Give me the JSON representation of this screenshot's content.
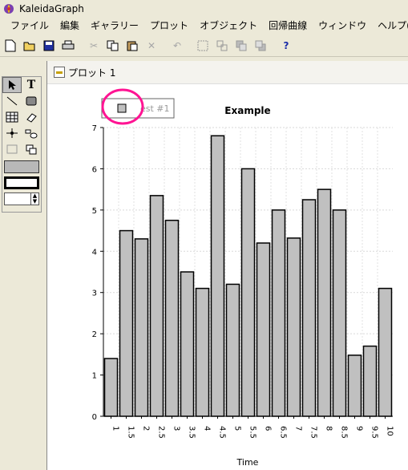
{
  "app": {
    "title": "KaleidaGraph"
  },
  "menu": [
    "ファイル",
    "編集",
    "ギャラリー",
    "プロット",
    "オブジェクト",
    "回帰曲線",
    "ウィンドウ",
    "ヘルプ(H)"
  ],
  "toolbar": {
    "help_label": "?",
    "buttons": [
      "new-icon",
      "open-icon",
      "save-icon",
      "print-icon",
      "cut-icon",
      "copy-icon",
      "paste-icon",
      "delete-icon",
      "undo-icon",
      "group-icon",
      "ungroup-icon",
      "bring-front-icon",
      "send-back-icon",
      "help-icon"
    ]
  },
  "window": {
    "title": "プロット 1"
  },
  "palette": {
    "text_tool": "T"
  },
  "chart_data": {
    "type": "bar",
    "title": "Example",
    "xlabel": "Time",
    "ylabel": "",
    "ylim": [
      0,
      7
    ],
    "yticks": [
      0,
      1,
      2,
      3,
      4,
      5,
      6,
      7
    ],
    "grid": true,
    "legend": {
      "placement": "top-left",
      "entries": [
        "Test #1"
      ],
      "label_visible": "est #1"
    },
    "bar_color": "#c0c0c0",
    "categories": [
      "1",
      "1.5",
      "2",
      "2.5",
      "3",
      "3.5",
      "4",
      "4.5",
      "5",
      "5.5",
      "6",
      "6.5",
      "7",
      "7.5",
      "8",
      "8.5",
      "9",
      "9.5",
      "10"
    ],
    "values": [
      1.4,
      4.5,
      4.3,
      5.35,
      4.75,
      3.5,
      3.1,
      6.8,
      3.2,
      6.0,
      4.2,
      5.0,
      4.32,
      5.25,
      5.5,
      5.0,
      1.48,
      1.7,
      3.1
    ]
  },
  "annotation": {
    "color": "#ff1493",
    "shape": "circle",
    "target": "legend"
  }
}
